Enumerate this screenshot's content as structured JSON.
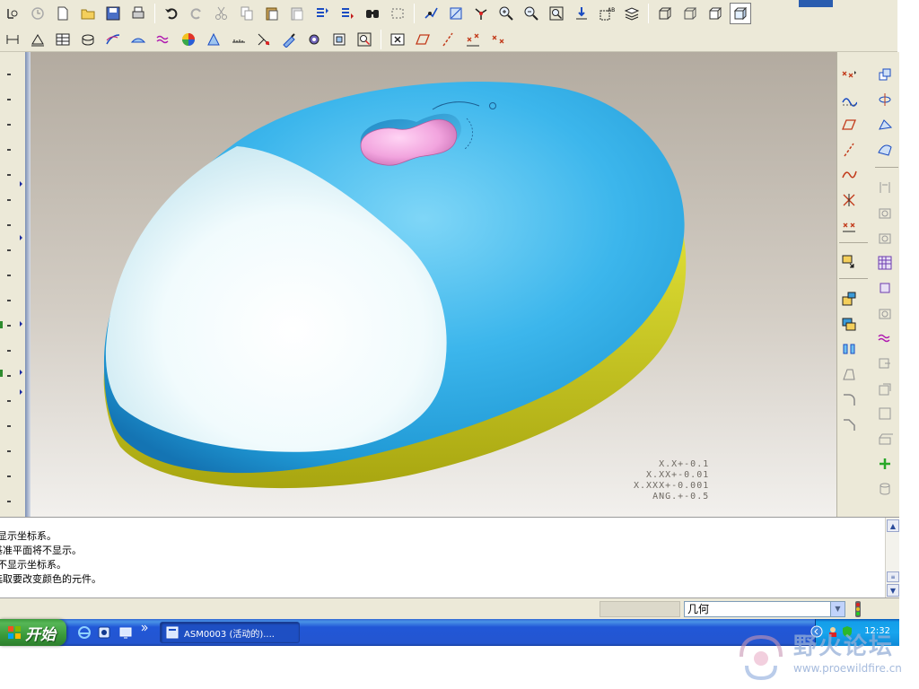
{
  "messages": [
    "显示坐标系。",
    "基准平面将不显示。",
    "不显示坐标系。",
    "选取要改变颜色的元件。"
  ],
  "tolerance": [
    "X.X+-0.1",
    "X.XX+-0.01",
    "X.XXX+-0.001",
    "ANG.+-0.5"
  ],
  "status": {
    "filter_value": "几何"
  },
  "taskbar": {
    "start_label": "开始",
    "task_item": "ASM0003 (活动的)....",
    "clock": "12:32"
  },
  "watermark": {
    "title": "野火论坛",
    "url": "www.proewildfire.cn"
  },
  "colors": {
    "mouse_body_blue": "#38b3ea",
    "mouse_cover_white": "#e9f7fa",
    "mouse_base_yellow": "#d9d91a",
    "scroll_pink": "#f2a4de",
    "toolbar_bg": "#ece9d8",
    "taskbar_blue": "#2456d0",
    "start_green": "#3a9a3a"
  },
  "toolbar_icons_row1": [
    "regenerate-icon",
    "open-icon",
    "new-icon",
    "open-folder-icon",
    "save-icon",
    "print-icon",
    "undo-icon",
    "redo-icon",
    "cut-icon",
    "copy-icon",
    "paste-icon",
    "paste-special-icon",
    "regenerate-model-icon",
    "regenerate-manager-icon",
    "find-icon",
    "select-box-icon",
    "orient-icon",
    "spin-center-icon",
    "datum-axis-icon",
    "zoom-in-icon",
    "zoom-out-icon",
    "refit-icon",
    "reorient-icon",
    "saved-views-icon",
    "layers-icon",
    "wireframe-icon",
    "hidden-line-icon",
    "no-hidden-icon",
    "shading-icon"
  ],
  "toolbar_icons_row2": [
    "dimension-icon",
    "ruler-icon",
    "table-icon",
    "symbol-icon",
    "sketch-icon",
    "surface-icon",
    "wave-icon",
    "appearance-icon",
    "render-icon",
    "measure-icon",
    "analysis-icon",
    "probe-icon",
    "gear-icon",
    "repaint-icon",
    "zoom-select-icon",
    "close-window-icon",
    "datum-plane-display-icon",
    "datum-axis-display-icon",
    "datum-point-display-icon",
    "csys-display-icon"
  ]
}
